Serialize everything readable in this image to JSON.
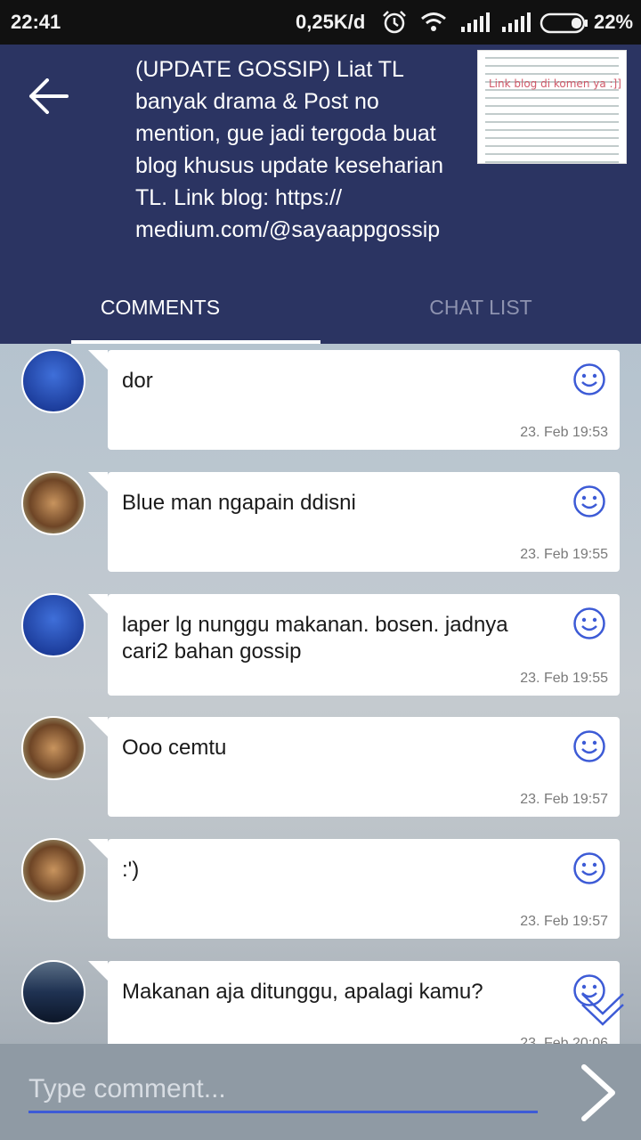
{
  "status_bar": {
    "time": "22:41",
    "network_speed": "0,25K/d",
    "battery": "22%"
  },
  "header": {
    "post_title": "(UPDATE GOSSIP) Liat TL banyak drama & Post no mention, gue jadi tergoda buat blog khusus update keseharian TL. Link blog: https:// medium.com/@sayaappgossip",
    "thumbnail_caption": "Link blog di komen ya :]]",
    "tabs": [
      {
        "label": "COMMENTS",
        "active": true
      },
      {
        "label": "CHAT LIST",
        "active": false
      }
    ]
  },
  "messages": [
    {
      "avatar": "blue-man-avatar",
      "text": "dor",
      "time": "23. Feb 19:53"
    },
    {
      "avatar": "kid-avatar",
      "text": "Blue man ngapain ddisni",
      "time": "23. Feb 19:55"
    },
    {
      "avatar": "blue-man-avatar",
      "text": "laper lg nunggu makanan. bosen. jadnya cari2 bahan gossip",
      "time": "23. Feb 19:55"
    },
    {
      "avatar": "kid-avatar",
      "text": "Ooo cemtu",
      "time": "23. Feb 19:57"
    },
    {
      "avatar": "kid-avatar",
      "text": ":')",
      "time": "23. Feb 19:57"
    },
    {
      "avatar": "photo-avatar",
      "text": "Makanan aja ditunggu, apalagi kamu?",
      "time": "23. Feb 20:06"
    }
  ],
  "input": {
    "placeholder": "Type comment..."
  },
  "colors": {
    "header_bg": "#2b3462",
    "accent": "#3d5bd6",
    "bubble_bg": "#ffffff",
    "input_bar_bg": "#8f9aa4"
  }
}
